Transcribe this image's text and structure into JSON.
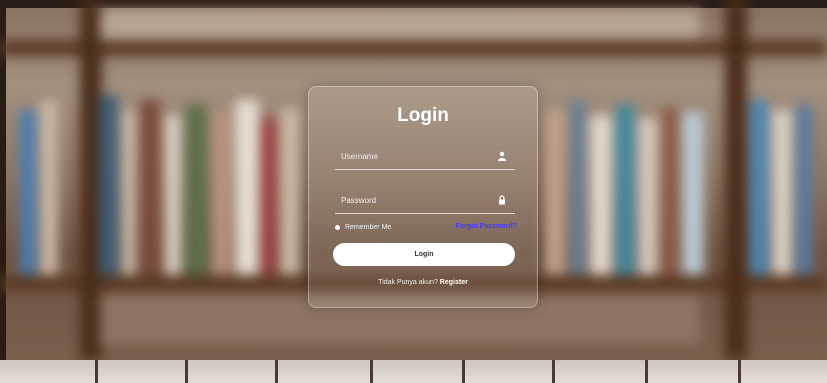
{
  "login": {
    "title": "Login",
    "username_placeholder": "Username",
    "password_placeholder": "Password",
    "remember_label": "Remember Me",
    "forgot_label": "Forgot Password?",
    "button_label": "Login",
    "register_prompt": "Tidak Punya akun?",
    "register_link": "Register"
  },
  "icons": {
    "username": "user-icon",
    "password": "lock-icon"
  },
  "colors": {
    "forgot_link": "#3f3cff",
    "button_bg": "#ffffff",
    "card_border": "rgba(255,255,255,0.35)"
  }
}
